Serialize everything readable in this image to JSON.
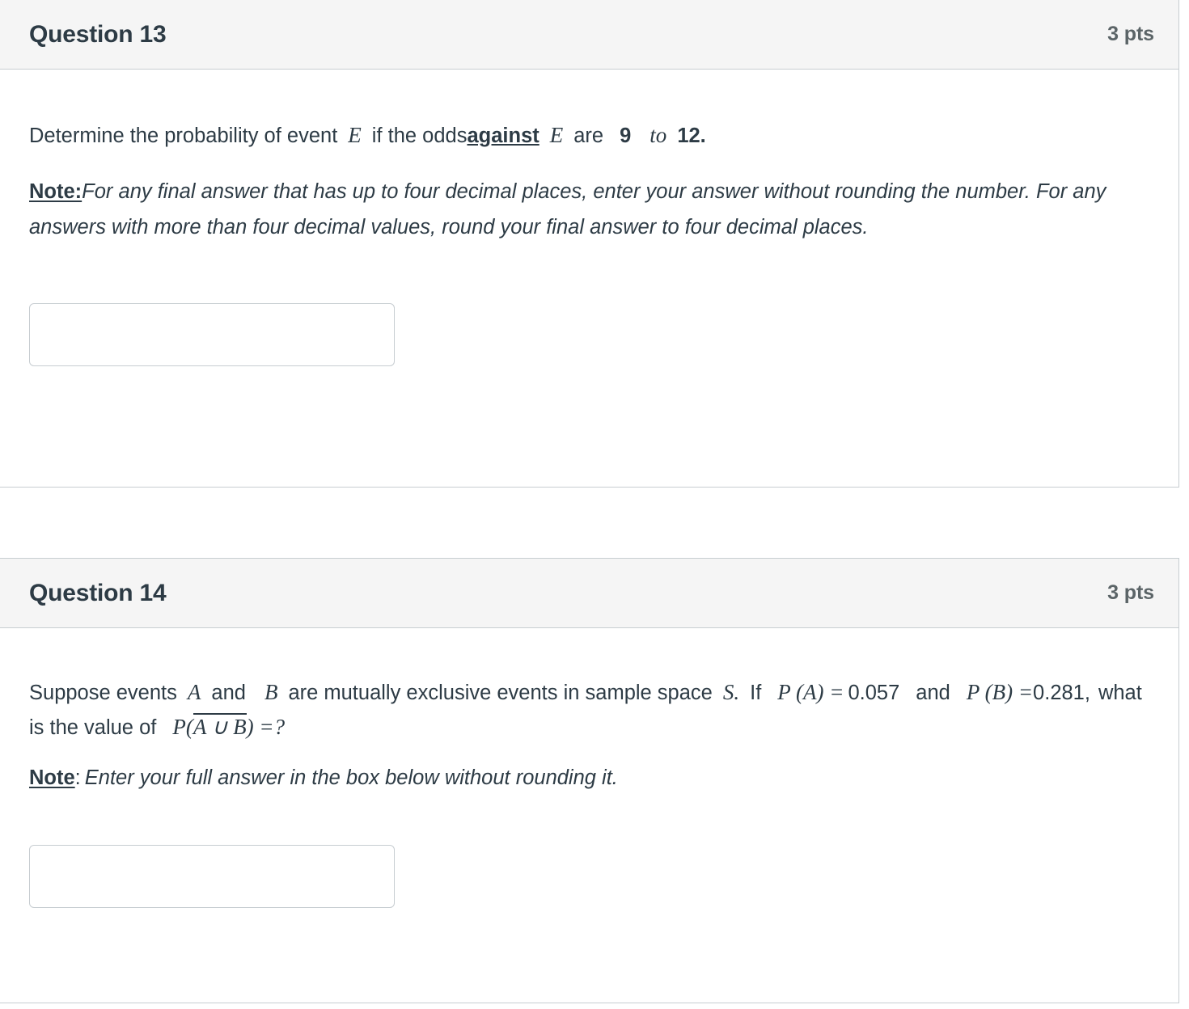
{
  "questions": [
    {
      "name": "Question 13",
      "points": "3 pts",
      "prompt": {
        "lead": "Determine the probability of event",
        "var1": "E",
        "mid1": "if the odds",
        "against": "against",
        "var2": "E",
        "mid2": "are",
        "num1": "9",
        "to": "to",
        "num2": "12."
      },
      "note": {
        "label": "Note:",
        "text": "For any final answer that has up to  four decimal places, enter your answer without rounding the number. For any answers with more than four decimal values, round your final answer to four decimal places."
      },
      "answer": {
        "value": "",
        "placeholder": ""
      }
    },
    {
      "name": "Question 14",
      "points": "3 pts",
      "prompt": {
        "lead": "Suppose events",
        "var_a": "A",
        "and": "and",
        "var_b": "B",
        "mid1": "are mutually exclusive events in sample space",
        "var_s": "S.",
        "if": "If",
        "pa": "P (A) =",
        "pa_value": "0.057",
        "and2": "and",
        "pb": "P (B) =",
        "pb_value": "0.281,",
        "mid2": "what is the value of",
        "expr_p": "P(",
        "expr_overline": "A ∪ B",
        "expr_close": ") =?"
      },
      "note": {
        "label": "Note",
        "colon": ":",
        "text": "Enter your full answer in the box below without rounding it."
      },
      "answer": {
        "value": "",
        "placeholder": ""
      }
    }
  ]
}
